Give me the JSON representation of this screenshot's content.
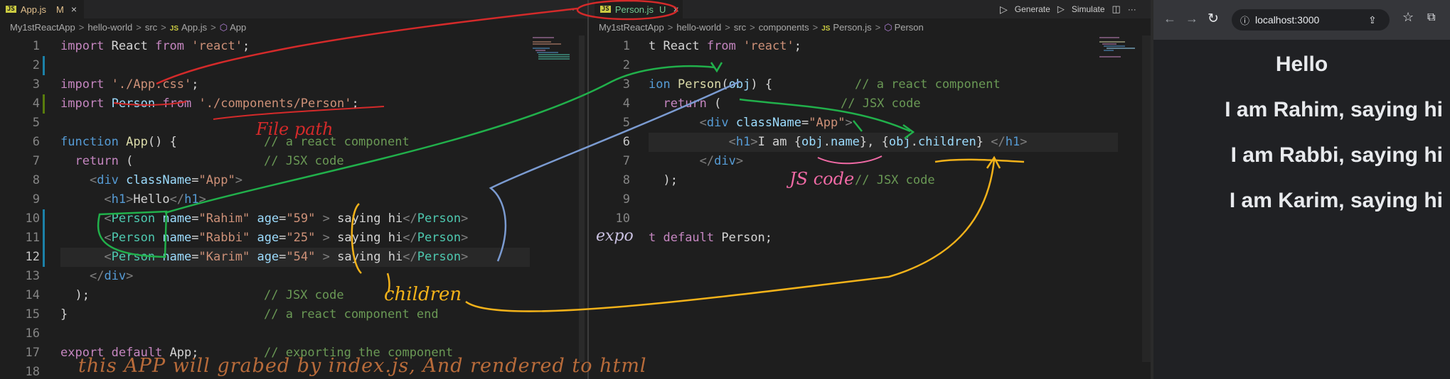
{
  "left_editor": {
    "tab": {
      "filename": "App.js",
      "status": "M",
      "close": "×"
    },
    "actions": {
      "more": "···"
    },
    "breadcrumb": [
      "My1stReactApp",
      "hello-world",
      "src",
      "App.js",
      "App"
    ],
    "lines": [
      {
        "n": "1"
      },
      {
        "n": "2"
      },
      {
        "n": "3"
      },
      {
        "n": "4"
      },
      {
        "n": "5"
      },
      {
        "n": "6"
      },
      {
        "n": "7"
      },
      {
        "n": "8"
      },
      {
        "n": "9"
      },
      {
        "n": "10"
      },
      {
        "n": "11"
      },
      {
        "n": "12"
      },
      {
        "n": "13"
      },
      {
        "n": "14"
      },
      {
        "n": "15"
      },
      {
        "n": "16"
      },
      {
        "n": "17"
      },
      {
        "n": "18"
      }
    ],
    "code": {
      "l1": [
        "import",
        " React ",
        "from",
        " ",
        "'react'",
        ";"
      ],
      "l3": [
        "import",
        " ",
        "'./App.css'",
        ";"
      ],
      "l4": [
        "import",
        " Person ",
        "from",
        " ",
        "'./components/Person'",
        ";"
      ],
      "l6": [
        "function",
        " ",
        "App",
        "() {",
        "// a react component"
      ],
      "l7": [
        "return",
        " (",
        "// JSX code"
      ],
      "l8": [
        "<",
        "div",
        " ",
        "className",
        "=",
        "\"App\"",
        ">"
      ],
      "l9": [
        "<",
        "h1",
        ">",
        "Hello",
        "</",
        "h1",
        ">"
      ],
      "l10": [
        "<",
        "Person",
        " ",
        "name",
        "=",
        "\"Rahim\"",
        " ",
        "age",
        "=",
        "\"59\"",
        " > ",
        "saying hi",
        "</",
        "Person",
        ">"
      ],
      "l11": [
        "<",
        "Person",
        " ",
        "name",
        "=",
        "\"Rabbi\"",
        " ",
        "age",
        "=",
        "\"25\"",
        " > ",
        "saying hi",
        "</",
        "Person",
        ">"
      ],
      "l12": [
        "<",
        "Person",
        " ",
        "name",
        "=",
        "\"Karim\"",
        " ",
        "age",
        "=",
        "\"54\"",
        " > ",
        "saying hi",
        "</",
        "Person",
        ">"
      ],
      "l13": [
        "</",
        "div",
        ">"
      ],
      "l14": [
        ");",
        "// JSX code"
      ],
      "l15": [
        "}",
        "// a react component end"
      ],
      "l17": [
        "export",
        " ",
        "default",
        " App;",
        "// exporting the component"
      ]
    }
  },
  "right_editor": {
    "tab": {
      "filename": "Person.js",
      "status": "U",
      "close": "×"
    },
    "actions": {
      "generate": "Generate",
      "simulate": "Simulate",
      "more": "···"
    },
    "breadcrumb": [
      "My1stReactApp",
      "hello-world",
      "src",
      "components",
      "Person.js",
      "Person"
    ],
    "lines": [
      {
        "n": "1"
      },
      {
        "n": "2"
      },
      {
        "n": "3"
      },
      {
        "n": "4"
      },
      {
        "n": "5"
      },
      {
        "n": "6"
      },
      {
        "n": "7"
      },
      {
        "n": "8"
      },
      {
        "n": "9"
      },
      {
        "n": "10"
      }
    ],
    "code": {
      "l1": [
        "t React ",
        "from",
        " ",
        "'react'",
        ";"
      ],
      "l3": [
        "ion ",
        "Person",
        "(",
        "obj",
        ") {",
        "// a react component"
      ],
      "l4": [
        "return",
        " (",
        "// JSX code"
      ],
      "l5": [
        "<",
        "div",
        " ",
        "className",
        "=",
        "\"App\"",
        ">"
      ],
      "l6": [
        "<",
        "h1",
        ">",
        "I am {",
        "obj",
        ".",
        "name",
        "}, {",
        "obj",
        ".",
        "children",
        "} ",
        "</",
        "h1",
        ">"
      ],
      "l7": [
        "</",
        "div",
        ">"
      ],
      "l8": [
        ");",
        "// JSX code"
      ],
      "l11": [
        "t ",
        "default",
        " Person;"
      ]
    }
  },
  "browser": {
    "url": "localhost:3000",
    "heading": "Hello",
    "paragraphs": [
      "I am Rahim, saying hi",
      "I am Rabbi, saying hi",
      "I am Karim, saying hi"
    ]
  },
  "annotations": {
    "file_path": "File path",
    "js_code": "JS code",
    "children": "children",
    "expo": "expo",
    "bottom_note": "this APP will grabed by index.js, And rendered to html"
  },
  "colors": {
    "red": "#d42a2a",
    "green": "#21b04b",
    "blue": "#7b9bd1",
    "yellow": "#f2b21a",
    "pink": "#f06aa5",
    "brown": "#b86b3a"
  }
}
